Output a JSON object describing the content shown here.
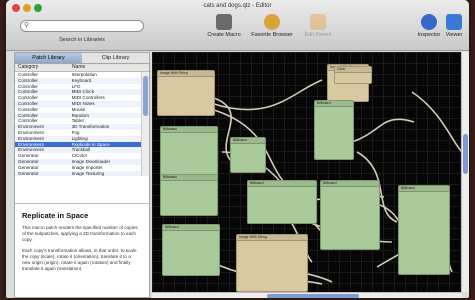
{
  "window": {
    "title": "cats and dogs.qtz - Editor"
  },
  "search": {
    "placeholder": "",
    "caption": "Search in Libraries"
  },
  "toolbar": {
    "buttons": [
      {
        "label": "Create Macro",
        "icon": "create-macro-icon",
        "color": "#6b6b6b"
      },
      {
        "label": "Favorite Browser",
        "icon": "favorite-browser-icon",
        "color": "#d8a336"
      },
      {
        "label": "Edit Parent",
        "icon": "edit-parent-icon",
        "color": "#e6b070"
      },
      {
        "label": "Inspector",
        "icon": "inspector-icon",
        "color": "#3568c8"
      },
      {
        "label": "Viewer",
        "icon": "viewer-icon",
        "color": "#3a78d8"
      }
    ]
  },
  "library": {
    "tabs": [
      "Patch Library",
      "Clip Library"
    ],
    "active_tab": 0,
    "columns": [
      "Category",
      "Name"
    ],
    "rows": [
      {
        "category": "Controller",
        "name": "Interpolation"
      },
      {
        "category": "Controller",
        "name": "Keyboard"
      },
      {
        "category": "Controller",
        "name": "LFO"
      },
      {
        "category": "Controller",
        "name": "MIDI Clock"
      },
      {
        "category": "Controller",
        "name": "MIDI Controllers"
      },
      {
        "category": "Controller",
        "name": "MIDI Notes"
      },
      {
        "category": "Controller",
        "name": "Mouse"
      },
      {
        "category": "Controller",
        "name": "Random"
      },
      {
        "category": "Controller",
        "name": "Tablet"
      },
      {
        "category": "Environment",
        "name": "3D Transformation"
      },
      {
        "category": "Environment",
        "name": "Fog"
      },
      {
        "category": "Environment",
        "name": "Lighting"
      },
      {
        "category": "Environment",
        "name": "Replicate in Space"
      },
      {
        "category": "Environment",
        "name": "Trackball"
      },
      {
        "category": "Generator",
        "name": "CIColor"
      },
      {
        "category": "Generator",
        "name": "Image Downloader"
      },
      {
        "category": "Generator",
        "name": "Image Importer"
      },
      {
        "category": "Generator",
        "name": "Image Texturing"
      }
    ],
    "selected_row": 12
  },
  "description": {
    "title": "Replicate in Space",
    "paragraphs": [
      "This macro patch renders the specified number of copies of the subpatches, applying a 3D transformation to each copy.",
      "Each copy's transformation allows, in that order, to scale the copy (scale), rotate it (orientation), translate it to a new origin (origin), rotate it again (rotation) and finally translate it again (translation)."
    ]
  },
  "canvas": {
    "patch_titles": [
      "Image With String",
      "Image With String",
      "Clear",
      "Billboard",
      "Billboard",
      "Billboard",
      "Billboard",
      "Billboard",
      "Billboard",
      "Image With String",
      "Billboard",
      "Billboard"
    ]
  },
  "colors": {
    "canvas_bg": "#060606",
    "patch_green": "#a9c99a",
    "patch_tan": "#d9c9a2",
    "selection": "#3d6bd0",
    "wire": "#e9e2c8"
  }
}
